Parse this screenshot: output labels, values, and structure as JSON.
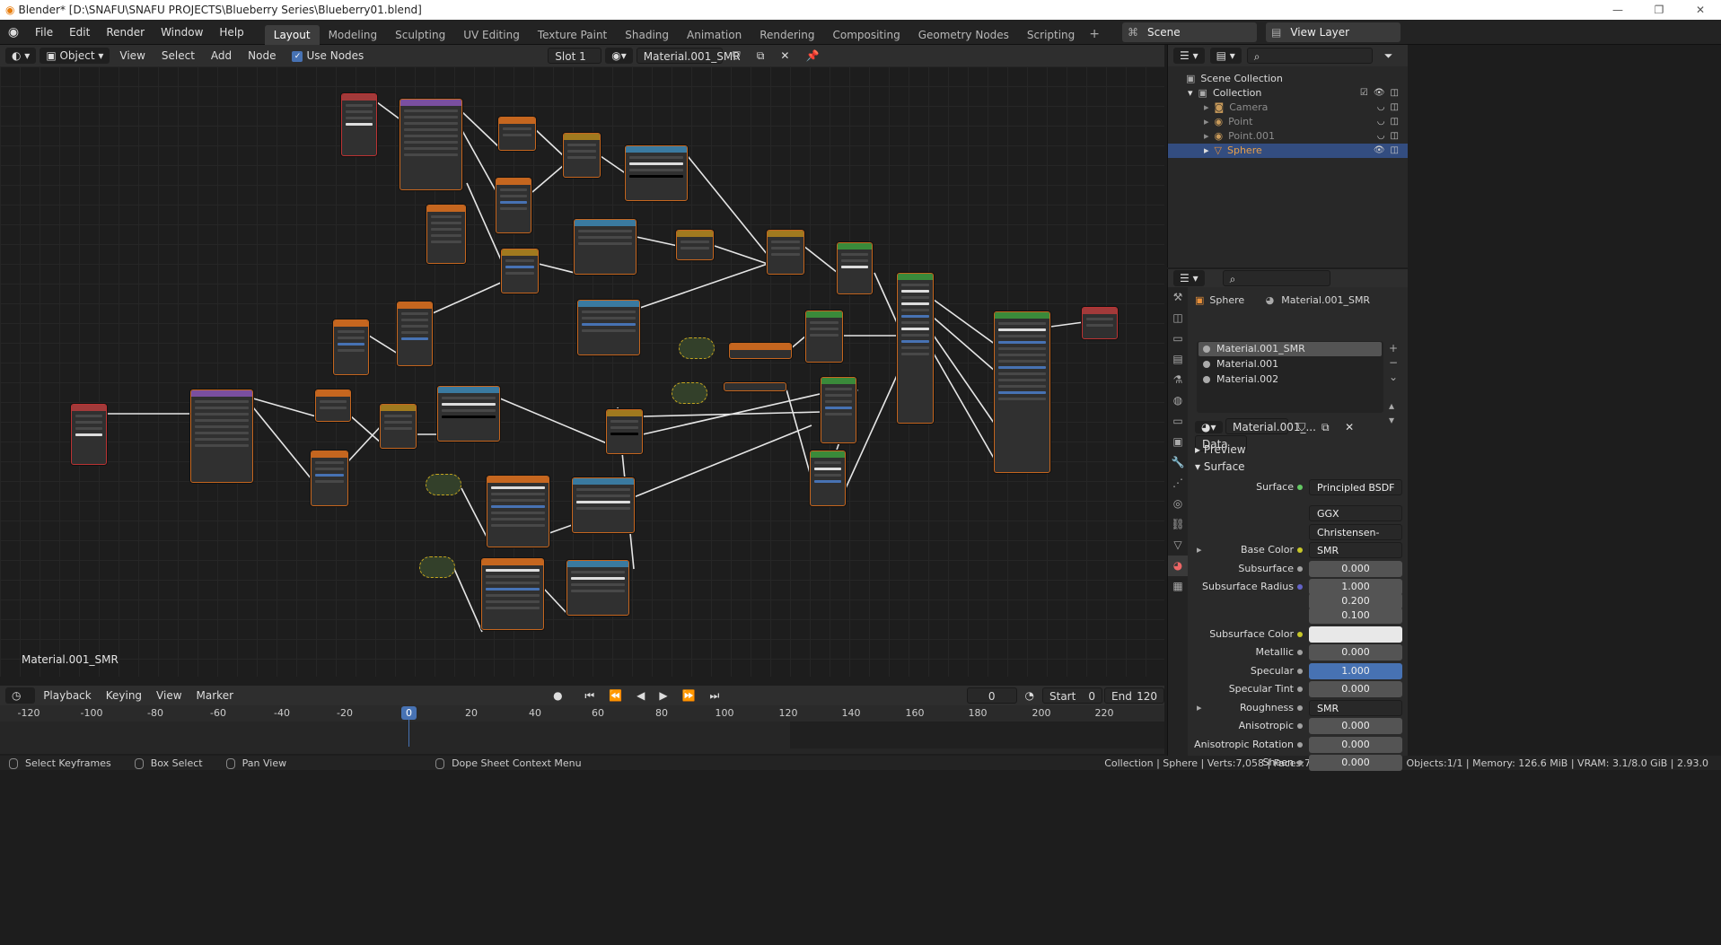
{
  "window": {
    "title": "Blender* [D:\\SNAFU\\SNAFU PROJECTS\\Blueberry Series\\Blueberry01.blend]",
    "controls": [
      "—",
      "❐",
      "✕"
    ]
  },
  "menu": {
    "items": [
      "File",
      "Edit",
      "Render",
      "Window",
      "Help"
    ],
    "workspaces": [
      "Layout",
      "Modeling",
      "Sculpting",
      "UV Editing",
      "Texture Paint",
      "Shading",
      "Animation",
      "Rendering",
      "Compositing",
      "Geometry Nodes",
      "Scripting"
    ],
    "active_workspace": "Layout",
    "add_tab": "+",
    "scene": "Scene",
    "view_layer": "View Layer"
  },
  "node_editor": {
    "mode": "Object",
    "menus": [
      "View",
      "Select",
      "Add",
      "Node"
    ],
    "use_nodes_label": "Use Nodes",
    "slot": "Slot 1",
    "material": "Material.001_SMR",
    "canvas_label": "Material.001_SMR"
  },
  "timeline": {
    "menus": [
      "Playback",
      "Keying",
      "View",
      "Marker"
    ],
    "current_frame": "0",
    "start_label": "Start",
    "start": "0",
    "end_label": "End",
    "end": "120",
    "ticks": [
      "-120",
      "-100",
      "-80",
      "-60",
      "-40",
      "-20",
      "0",
      "20",
      "40",
      "60",
      "80",
      "100",
      "120",
      "140",
      "160",
      "180",
      "200",
      "220"
    ],
    "playhead": "0"
  },
  "status": {
    "select_keyframes": "Select Keyframes",
    "box_select": "Box Select",
    "pan_view": "Pan View",
    "context_menu": "Dope Sheet Context Menu",
    "stats": "Collection | Sphere | Verts:7,058 | Faces:7,056 | Tris:14,112 | Objects:1/1 | Memory: 126.6 MiB | VRAM: 3.1/8.0 GiB | 2.93.0"
  },
  "outliner": {
    "scene_collection": "Scene Collection",
    "collection": "Collection",
    "objects": [
      "Camera",
      "Point",
      "Point.001",
      "Sphere"
    ],
    "selected": "Sphere"
  },
  "properties": {
    "object": "Sphere",
    "material_header": "Material.001_SMR",
    "materials": [
      "Material.001_SMR",
      "Material.001",
      "Material.002"
    ],
    "material_field": "Material.001_...",
    "data_link": "Data",
    "preview_label": "Preview",
    "surface_section": "Surface",
    "rows": [
      {
        "label": "Surface",
        "value": "Principled BSDF",
        "dot": "green",
        "style": "left"
      },
      {
        "label": "",
        "value": "GGX",
        "dot": "",
        "style": "dd"
      },
      {
        "label": "",
        "value": "Christensen-Burley",
        "dot": "",
        "style": "dd"
      },
      {
        "label": "Base Color",
        "value": "SMR",
        "dot": "yellow",
        "style": "left"
      },
      {
        "label": "Subsurface",
        "value": "0.000",
        "dot": "grey",
        "style": "num"
      },
      {
        "label": "Subsurface Radius",
        "value": "1.000",
        "dot": "purple",
        "style": "num"
      },
      {
        "label": "",
        "value": "0.200",
        "dot": "",
        "style": "num"
      },
      {
        "label": "",
        "value": "0.100",
        "dot": "",
        "style": "num"
      },
      {
        "label": "Subsurface Color",
        "value": "",
        "dot": "yellow",
        "style": "white"
      },
      {
        "label": "Metallic",
        "value": "0.000",
        "dot": "grey",
        "style": "num"
      },
      {
        "label": "Specular",
        "value": "1.000",
        "dot": "grey",
        "style": "blue"
      },
      {
        "label": "Specular Tint",
        "value": "0.000",
        "dot": "grey",
        "style": "num"
      },
      {
        "label": "Roughness",
        "value": "SMR",
        "dot": "grey",
        "style": "left"
      },
      {
        "label": "Anisotropic",
        "value": "0.000",
        "dot": "grey",
        "style": "num"
      },
      {
        "label": "Anisotropic Rotation",
        "value": "0.000",
        "dot": "grey",
        "style": "num"
      },
      {
        "label": "Sheen",
        "value": "0.000",
        "dot": "grey",
        "style": "num"
      }
    ]
  },
  "colors": {
    "accent": "#4772b3",
    "node_frame": "#c5661f",
    "selection": "#334d80"
  }
}
